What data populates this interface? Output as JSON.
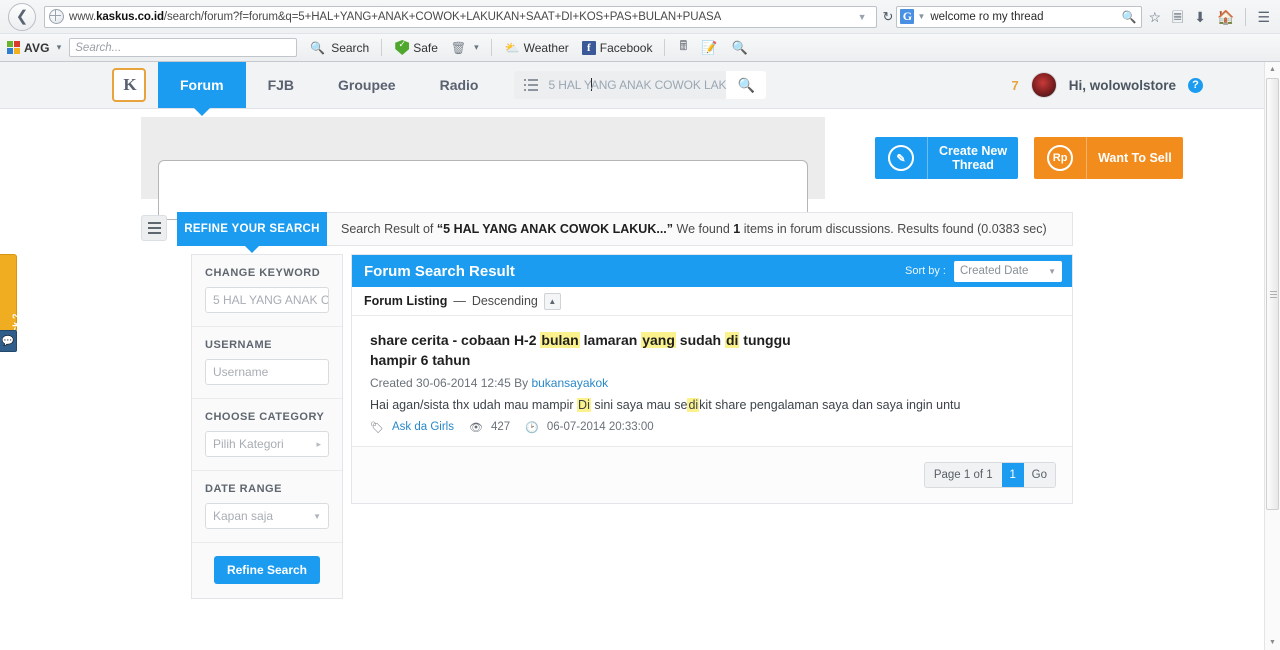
{
  "browser": {
    "back_icon": "back-arrow-icon",
    "site_icon": "globe-icon",
    "url_prefix": "www.",
    "url_domain": "kaskus.co.id",
    "url_path": "/search/forum?f=forum&q=5+HAL+YANG+ANAK+COWOK+LAKUKAN+SAAT+DI+KOS+PAS+BULAN+PUASA",
    "url_dropdown_icon": "chevron-down-icon",
    "reload_icon": "reload-icon",
    "search_engine": "G",
    "search_query": "welcome ro my thread",
    "search_icon": "magnifier-icon",
    "icons": [
      "bookmark-star-icon",
      "reading-list-icon",
      "downloads-icon",
      "home-icon",
      "menu-icon"
    ]
  },
  "avg_toolbar": {
    "brand": "AVG",
    "brand_caret": "▾",
    "search_placeholder": "Search...",
    "search_button": "Search",
    "safe_button": "Safe",
    "trash_icon": "trash-icon",
    "trash_caret": "▾",
    "weather_button": "Weather",
    "facebook_button": "Facebook",
    "facebook_glyph": "f",
    "extra_icons": [
      "calculator-icon",
      "notepad-icon",
      "search-folder-icon"
    ]
  },
  "nav": {
    "logo": "K",
    "items": [
      {
        "label": "Forum",
        "active": true
      },
      {
        "label": "FJB",
        "active": false
      },
      {
        "label": "Groupee",
        "active": false
      },
      {
        "label": "Radio",
        "active": false
      }
    ],
    "search_value": "5 HAL Y|ANG ANAK COWOK LAK",
    "search_value_before": "5 HAL Y",
    "search_value_after": "ANG ANAK COWOK LAK",
    "search_button_icon": "magnifier-icon",
    "list_icon": "list-icon",
    "notification_count": "7",
    "greeting": "Hi, wolowolstore",
    "help_icon": "?"
  },
  "cta": {
    "create_thread": {
      "icon": "pencil-icon",
      "line1": "Create New",
      "line2": "Thread",
      "color": "#1b9cf0"
    },
    "want_to_sell": {
      "icon": "Rp",
      "label": "Want To Sell",
      "color": "#f28c1c"
    }
  },
  "feedback": {
    "label": "Feedback ?",
    "icon": "feedback-widget-icon"
  },
  "refine_bar": {
    "menu_icon": "hamburger-icon",
    "tab_label": "REFINE YOUR SEARCH",
    "result_prefix": "Search Result of ",
    "result_query": "“5 HAL YANG ANAK COWOK LAKUK...”",
    "result_mid": " We found ",
    "result_count": "1",
    "result_suffix": " items in forum discussions. Results found (0.0383 sec)"
  },
  "refine_panel": {
    "blocks": [
      {
        "label": "CHANGE KEYWORD",
        "value": "5 HAL YANG ANAK C",
        "type": "text",
        "icon": ""
      },
      {
        "label": "USERNAME",
        "value": "Username",
        "type": "text",
        "icon": ""
      },
      {
        "label": "CHOOSE CATEGORY",
        "value": "Pilih Kategori",
        "type": "select",
        "icon": "chevron-right-icon"
      },
      {
        "label": "DATE RANGE",
        "value": "Kapan saja",
        "type": "select",
        "icon": "chevron-down-icon"
      }
    ],
    "submit_label": "Refine Search"
  },
  "results": {
    "title": "Forum Search Result",
    "sort_by_label": "Sort by :",
    "sort_value": "Created Date",
    "sort_caret_icon": "chevron-down-icon",
    "listing_label": "Forum Listing",
    "listing_dash": "—",
    "listing_order": "Descending",
    "listing_dir_icon": "caret-up-icon",
    "items": [
      {
        "title_parts": [
          {
            "t": "share cerita - cobaan H-2 ",
            "hl": false
          },
          {
            "t": "bulan",
            "hl": true
          },
          {
            "t": " lamaran ",
            "hl": false
          },
          {
            "t": "yang",
            "hl": true
          },
          {
            "t": " sudah ",
            "hl": false
          },
          {
            "t": "di",
            "hl": true
          },
          {
            "t": " tunggu hampir 6 tahun",
            "hl": false
          }
        ],
        "meta_created": "Created 30-06-2014 12:45 By ",
        "meta_author": "bukansayakok",
        "snippet_parts": [
          {
            "t": "Hai agan/sista thx udah mau mampir ",
            "hl": false
          },
          {
            "t": "Di",
            "hl": true
          },
          {
            "t": " sini saya mau se",
            "hl": false
          },
          {
            "t": "di",
            "hl": true
          },
          {
            "t": "kit share pengalaman saya dan saya ingin untu",
            "hl": false
          }
        ],
        "category": "Ask da Girls",
        "category_icon": "tag-icon",
        "views": "427",
        "views_icon": "eye-icon",
        "date": "06-07-2014 20:33:00",
        "date_icon": "clock-icon"
      }
    ],
    "pager": {
      "info": "Page 1 of 1",
      "current": "1",
      "go_label": "Go"
    }
  },
  "scrollbar": {
    "up_icon": "caret-up-icon",
    "down_icon": "caret-down-icon"
  }
}
